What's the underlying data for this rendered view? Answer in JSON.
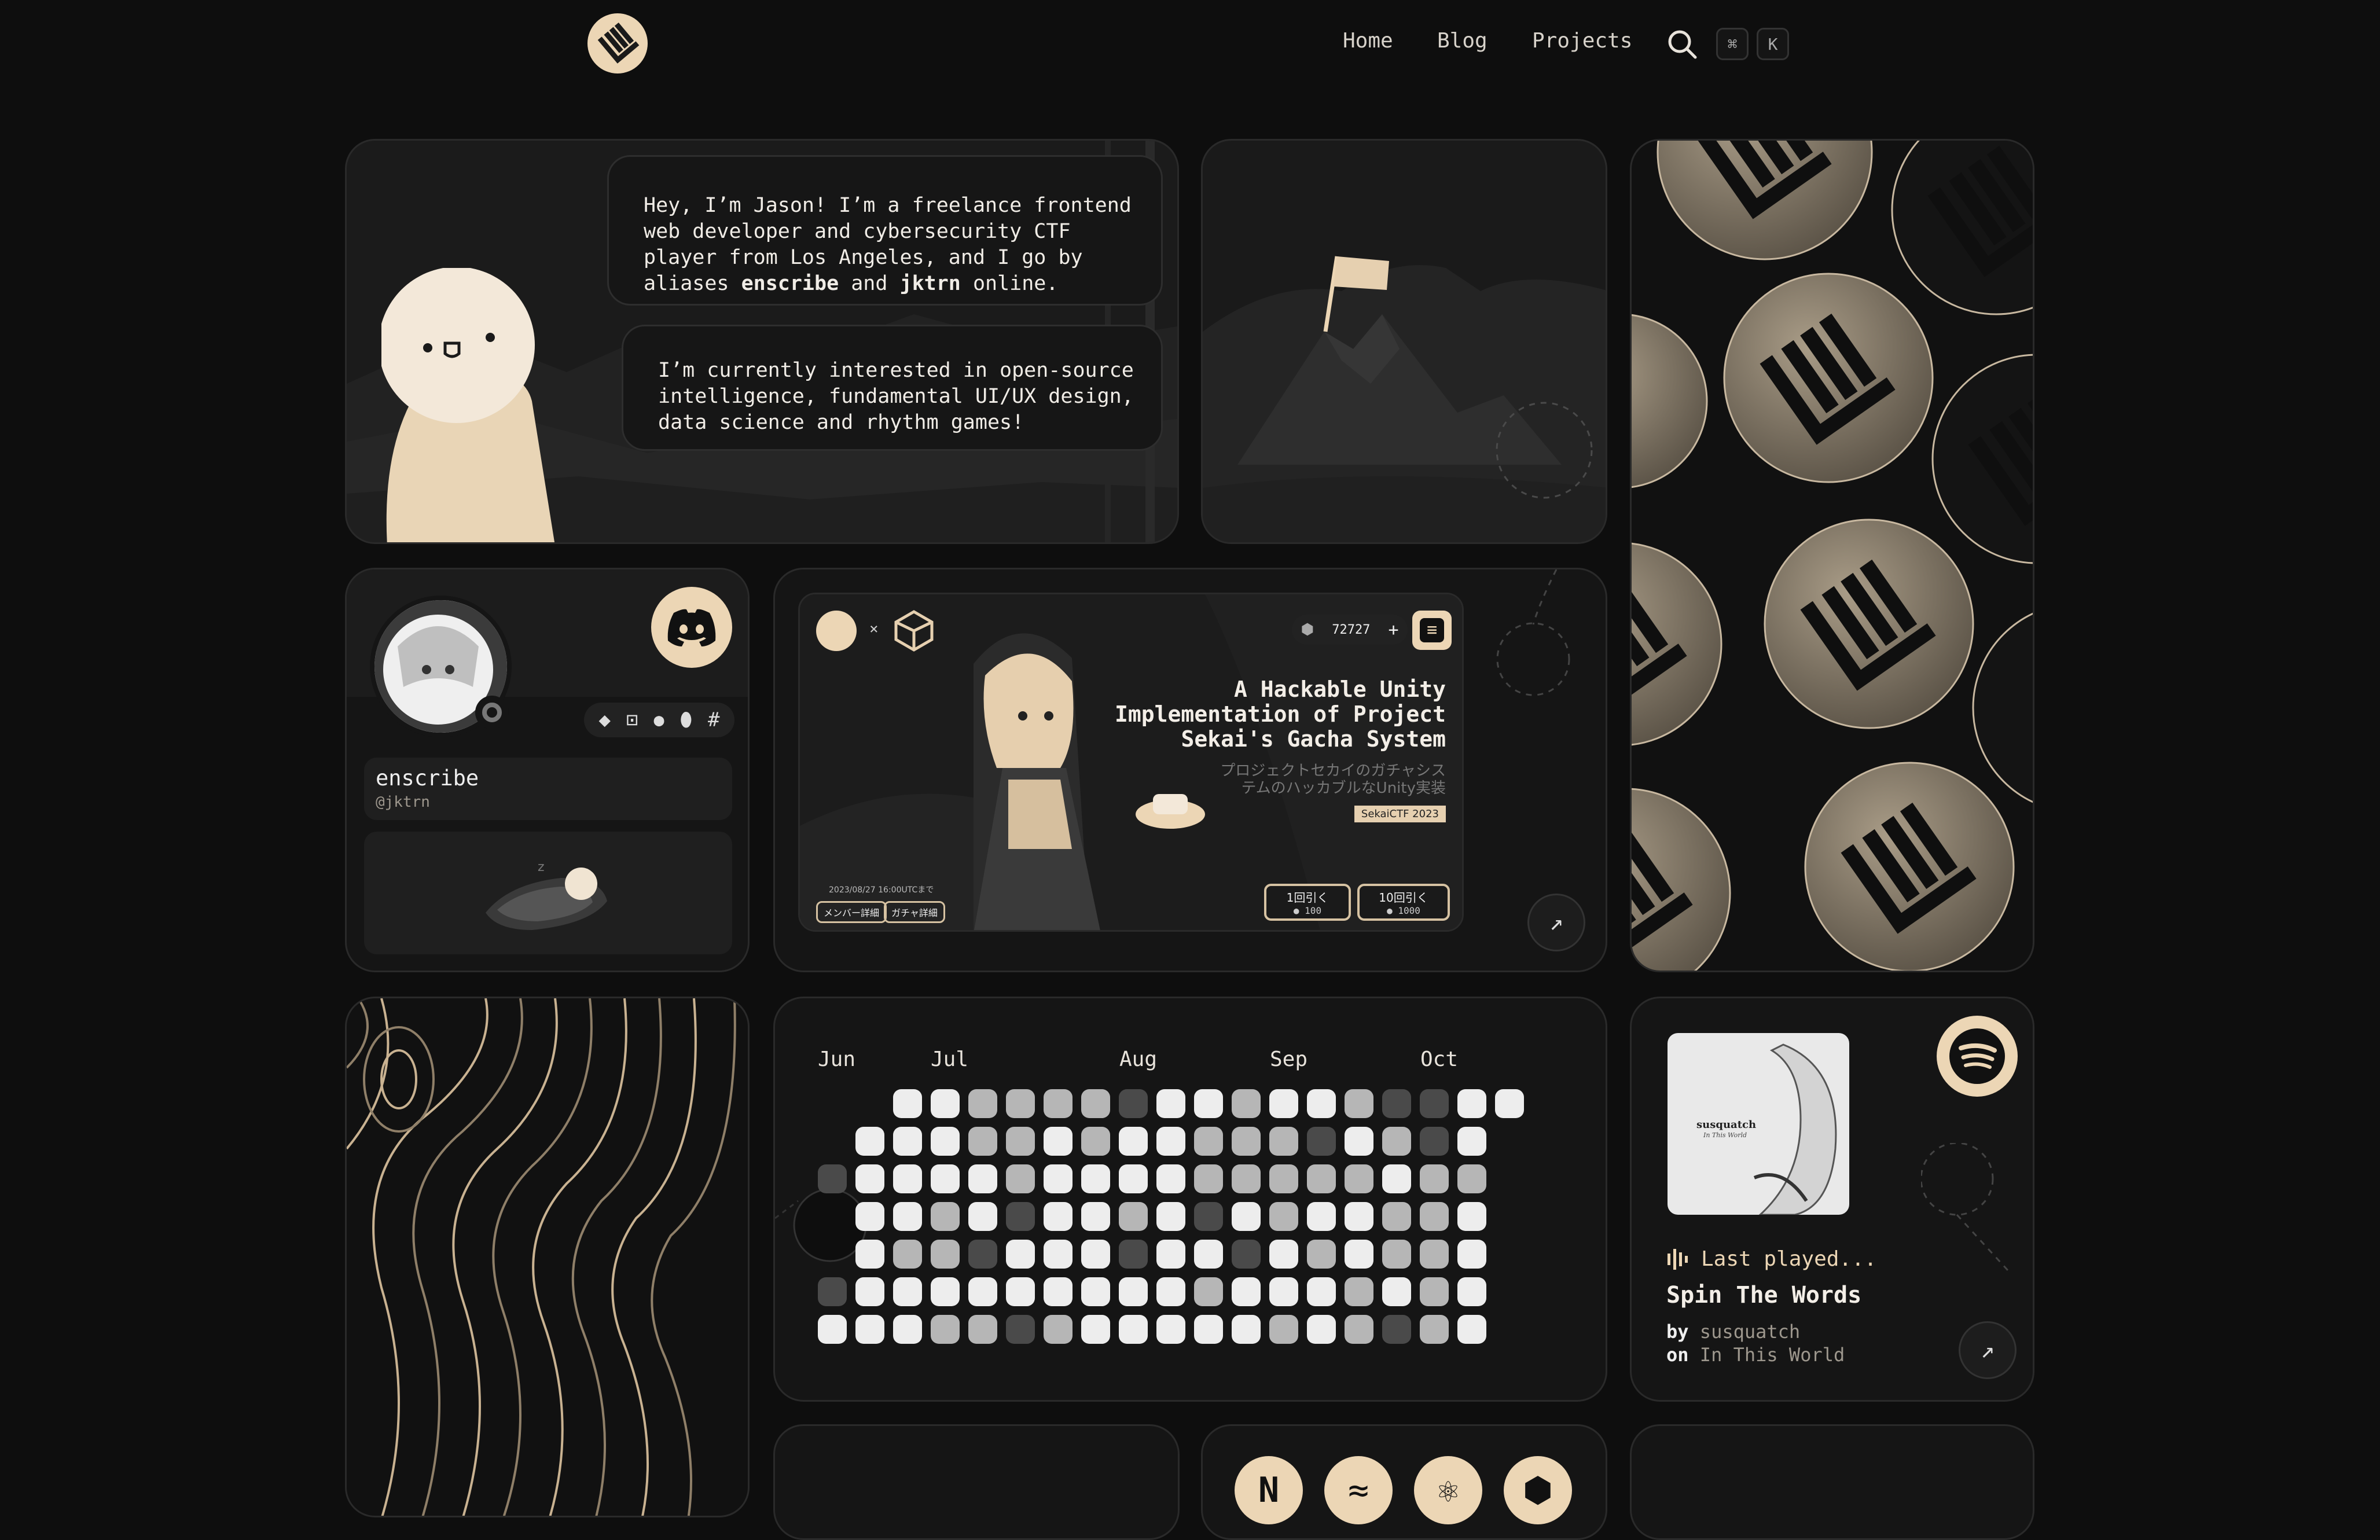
{
  "nav": {
    "items": [
      "Home",
      "Blog",
      "Projects"
    ],
    "shortcut": [
      "⌘",
      "K"
    ]
  },
  "intro": {
    "bubble1_a": "Hey, I’m Jason! I’m a freelance frontend\nweb developer and cybersecurity CTF\nplayer from Los Angeles, and I go by\naliases ",
    "alias1": "enscribe",
    "bubble1_b": " and ",
    "alias2": "jktrn",
    "bubble1_c": " online.",
    "bubble2": "I’m currently interested in open-source\nintelligence, fundamental UI/UX design,\ndata science and rhythm games!"
  },
  "profile": {
    "display_name": "enscribe",
    "handle": "@jktrn"
  },
  "project": {
    "title": "A Hackable Unity\nImplementation of Project\nSekai's Gacha System",
    "subtitle_jp": "プロジェクトセカイのガチャシス\nテムのハッカブルなUnity実装",
    "tag": "SekaiCTF 2023",
    "crystals": "72727",
    "date_text": "2023/08/27 16:00UTCまで",
    "btn_members": "メンバー詳細",
    "btn_gacha": "ガチャ詳細",
    "pull1": "1回引く",
    "pull1_cost": "100",
    "pull10": "10回引く",
    "pull10_cost": "1000"
  },
  "activity": {
    "months": [
      "Jun",
      "Jul",
      "Aug",
      "Sep",
      "Oct"
    ],
    "levels": [
      [
        0,
        0,
        3,
        3,
        2,
        2,
        2,
        2,
        1,
        3,
        3,
        2,
        3,
        3,
        2,
        1,
        1,
        3,
        3
      ],
      [
        0,
        3,
        3,
        3,
        2,
        2,
        3,
        2,
        3,
        3,
        2,
        2,
        2,
        1,
        3,
        2,
        1,
        3,
        0
      ],
      [
        1,
        3,
        3,
        3,
        3,
        2,
        3,
        3,
        3,
        3,
        2,
        2,
        2,
        2,
        2,
        3,
        2,
        2,
        0
      ],
      [
        0,
        3,
        3,
        2,
        3,
        1,
        3,
        3,
        2,
        3,
        1,
        3,
        2,
        3,
        3,
        2,
        2,
        3,
        0
      ],
      [
        0,
        3,
        2,
        2,
        1,
        3,
        3,
        3,
        1,
        3,
        3,
        1,
        3,
        2,
        3,
        2,
        2,
        3,
        0
      ],
      [
        1,
        3,
        3,
        3,
        3,
        3,
        3,
        3,
        3,
        3,
        2,
        3,
        3,
        3,
        2,
        3,
        2,
        3,
        0
      ],
      [
        3,
        3,
        3,
        2,
        2,
        1,
        2,
        3,
        3,
        3,
        3,
        3,
        2,
        3,
        2,
        1,
        2,
        3,
        0
      ]
    ],
    "colors": [
      "#161616",
      "#4a4a4a",
      "#b6b6b6",
      "#ededed"
    ]
  },
  "spotify": {
    "label": "Last played...",
    "track": "Spin The Words",
    "by_label": "by",
    "artist": "susquatch",
    "on_label": "on",
    "album": "In This World",
    "album_art_title": "susquatch",
    "album_art_sub": "In This World"
  },
  "theme": {
    "accent": "#ecd6b5",
    "bg": "#0e0e0e",
    "card": "#151515"
  }
}
